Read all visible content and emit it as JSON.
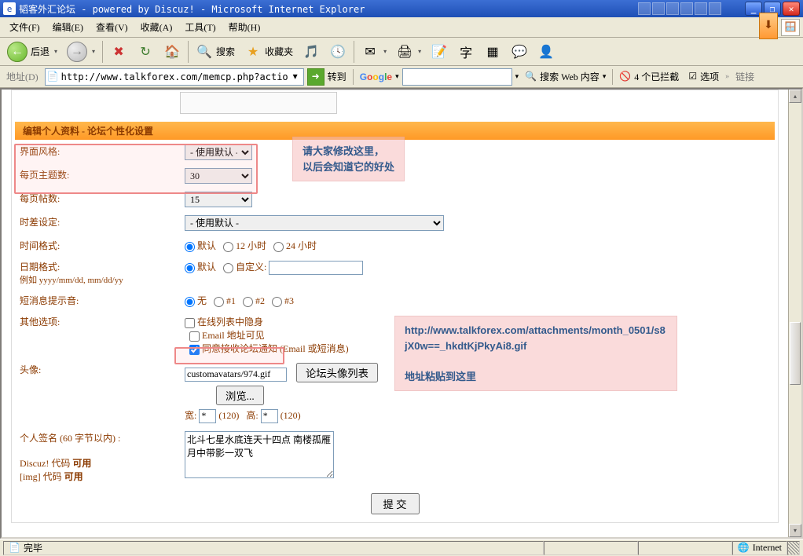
{
  "titlebar": {
    "text": "韬客外汇论坛 - powered by Discuz! - Microsoft Internet Explorer"
  },
  "menubar": {
    "items": [
      "文件(F)",
      "编辑(E)",
      "查看(V)",
      "收藏(A)",
      "工具(T)",
      "帮助(H)"
    ]
  },
  "toolbar": {
    "back": "后退",
    "search": "搜索",
    "fav": "收藏夹"
  },
  "addrbar": {
    "label": "地址(D)",
    "url": "http://www.talkforex.com/memcp.php?action=profil",
    "go": "转到",
    "google": "Google",
    "searchweb": "搜索 Web 内容",
    "blocked": "4 个已拦截",
    "options": "选项",
    "links": "链接"
  },
  "form": {
    "heading": "编辑个人资料 - 论坛个性化设置",
    "rows": {
      "style": {
        "label": "界面风格:",
        "value": "- 使用默认 -"
      },
      "topics": {
        "label": "每页主题数:",
        "value": "30"
      },
      "posts": {
        "label": "每页帖数:",
        "value": "15"
      },
      "tz": {
        "label": "时差设定:",
        "value": "- 使用默认 -"
      },
      "timefmt": {
        "label": "时间格式:",
        "opts": [
          "默认",
          "12 小时",
          "24 小时"
        ]
      },
      "datefmt": {
        "label": "日期格式:",
        "hint": "例如  yyyy/mm/dd, mm/dd/yy",
        "opts": [
          "默认",
          "自定义:"
        ]
      },
      "sound": {
        "label": "短消息提示音:",
        "opts": [
          "无",
          "#1",
          "#2",
          "#3"
        ]
      },
      "other": {
        "label": "其他选项:",
        "opts": [
          "在线列表中隐身",
          "Email 地址可见",
          "同意接收论坛通知 (Email 或短消息)"
        ]
      },
      "avatar": {
        "label": "头像:",
        "value": "customavatars/974.gif",
        "list_btn": "论坛头像列表",
        "browse": "浏览...",
        "wlabel": "宽:",
        "whint": "(120)",
        "hlabel": "高:",
        "hhint": "(120)",
        "star": "*"
      },
      "sig": {
        "label1": "个人签名 (60 字节以内) :",
        "label2": "Discuz! 代码 ",
        "label3": "[img] 代码 ",
        "allow": "可用",
        "value": "北斗七星水底连天十四点 南楼孤雁月中带影一双飞"
      }
    },
    "submit": "提 交"
  },
  "annotations": {
    "top_line1": "请大家修改这里，",
    "top_line2": "以后会知道它的好处",
    "bottom_url": "http://www.talkforex.com/attachments/month_0501/s8jX0w==_hkdtKjPkyAi8.gif",
    "bottom_text": "地址粘贴到这里"
  },
  "statusbar": {
    "done": "完毕",
    "zone": "Internet"
  }
}
